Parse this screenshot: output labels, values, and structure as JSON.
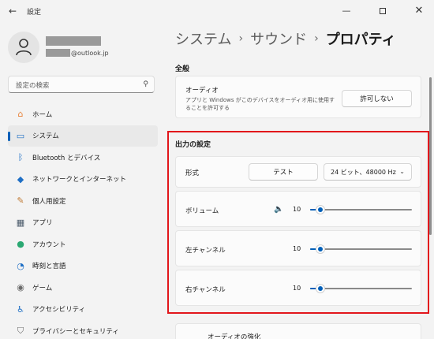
{
  "window": {
    "title": "設定",
    "back_glyph": "←",
    "minimize_glyph": "—",
    "close_glyph": "✕"
  },
  "user": {
    "email_suffix": "@outlook.jp"
  },
  "search": {
    "placeholder": "設定の検索",
    "icon": "search-icon"
  },
  "sidebar": {
    "items": [
      {
        "label": "ホーム",
        "icon": "home-icon",
        "color": "#e8833a",
        "glyph": "⌂"
      },
      {
        "label": "システム",
        "icon": "monitor-icon",
        "color": "#1f6fc5",
        "glyph": "▭",
        "active": true
      },
      {
        "label": "Bluetooth とデバイス",
        "icon": "bluetooth-icon",
        "color": "#1f6fc5",
        "glyph": "ᛒ"
      },
      {
        "label": "ネットワークとインターネット",
        "icon": "wifi-icon",
        "color": "#1f6fc5",
        "glyph": "◆"
      },
      {
        "label": "個人用設定",
        "icon": "brush-icon",
        "color": "#c07a35",
        "glyph": "✎"
      },
      {
        "label": "アプリ",
        "icon": "apps-icon",
        "color": "#4a5a6a",
        "glyph": "▦"
      },
      {
        "label": "アカウント",
        "icon": "account-icon",
        "color": "#2aa872",
        "glyph": "●"
      },
      {
        "label": "時刻と言語",
        "icon": "globe-clock-icon",
        "color": "#1f6fc5",
        "glyph": "◔"
      },
      {
        "label": "ゲーム",
        "icon": "gamepad-icon",
        "color": "#6b6b6b",
        "glyph": "◉"
      },
      {
        "label": "アクセシビリティ",
        "icon": "accessibility-icon",
        "color": "#1f6fc5",
        "glyph": "♿"
      },
      {
        "label": "プライバシーとセキュリティ",
        "icon": "shield-icon",
        "color": "#6b6b6b",
        "glyph": "⛉"
      }
    ]
  },
  "breadcrumb": {
    "items": [
      "システム",
      "サウンド",
      "プロパティ"
    ],
    "separator": "›"
  },
  "general": {
    "heading": "全般",
    "audio_title": "オーディオ",
    "audio_desc": "アプリと Windows がこのデバイスをオーディオ用に使用することを許可する",
    "deny_button": "許可しない"
  },
  "output": {
    "heading": "出力の設定",
    "format_label": "形式",
    "test_button": "テスト",
    "format_value": "24 ビット、48000 Hz",
    "volume_label": "ボリューム",
    "volume_value": "10",
    "left_label": "左チャンネル",
    "left_value": "10",
    "right_label": "右チャンネル",
    "right_value": "10"
  },
  "enhancements": {
    "title": "オーディオの強化"
  },
  "colors": {
    "accent": "#005fb8",
    "highlight_frame": "#e2161b"
  }
}
